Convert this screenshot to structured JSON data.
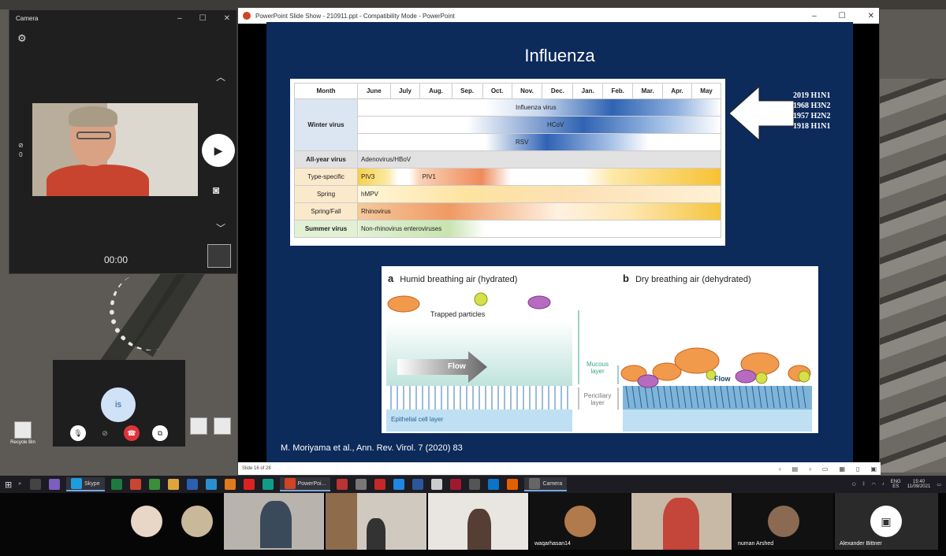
{
  "camera_app": {
    "title": "Camera",
    "timer": "00:00",
    "side_stat": "0"
  },
  "powerpoint": {
    "title": "PowerPoint Slide Show - 210911.ppt - Compatibility Mode - PowerPoint",
    "status": "Slide 16 of 28"
  },
  "slide": {
    "title": "Influenza",
    "table": {
      "month_header": "Month",
      "months": [
        "June",
        "July",
        "Aug.",
        "Sep.",
        "Oct.",
        "Nov.",
        "Dec.",
        "Jan.",
        "Feb.",
        "Mar.",
        "Apr.",
        "May"
      ],
      "rows": [
        {
          "category": "Winter virus",
          "label": "Influenza virus"
        },
        {
          "category": "",
          "label": "HCoV"
        },
        {
          "category": "",
          "label": "RSV"
        },
        {
          "category": "All-year virus",
          "label": "Adenovirus/HBoV"
        },
        {
          "category": "Type-specific",
          "label": "PIV3",
          "label2": "PIV1"
        },
        {
          "category": "Spring",
          "label": "hMPV"
        },
        {
          "category": "Spring/Fall",
          "label": "Rhinovirus"
        },
        {
          "category": "Summer virus",
          "label": "Non-rhinovirus enteroviruses"
        }
      ]
    },
    "pandemics": [
      "2019 H1N1",
      "1968 H3N2",
      "1957 H2N2",
      "1918 H1N1"
    ],
    "figure": {
      "a_letter": "a",
      "a_title": "Humid breathing air (hydrated)",
      "b_letter": "b",
      "b_title": "Dry breathing air (dehydrated)",
      "trapped": "Trapped particles",
      "flow": "Flow",
      "mucous": "Mucous layer",
      "periciliary": "Periciliary layer",
      "epithelial": "Epithelial cell layer",
      "flow_b": "Flow"
    },
    "citation": "M. Moriyama et al., Ann. Rev. Virol. 7 (2020) 83"
  },
  "call": {
    "self_initials": "is"
  },
  "desktop_icons": [
    "Recycle Bin"
  ],
  "taskbar": {
    "skype": "Skype",
    "powerpoint": "PowerPoi...",
    "camera": "Camera",
    "lang1": "ENG",
    "lang2": "ES",
    "time": "15:40",
    "date": "11/09/2021"
  },
  "participants": [
    {
      "name": ""
    },
    {
      "name": ""
    },
    {
      "name": ""
    },
    {
      "name": ""
    },
    {
      "name": ""
    },
    {
      "name": "waqarhasan14"
    },
    {
      "name": ""
    },
    {
      "name": "numan Arshed"
    },
    {
      "name": "Alexander Bittner"
    }
  ],
  "colors": {
    "slide_bg": "#0c2a5a",
    "accent": "#2f63b3",
    "hangup": "#e0343a"
  }
}
